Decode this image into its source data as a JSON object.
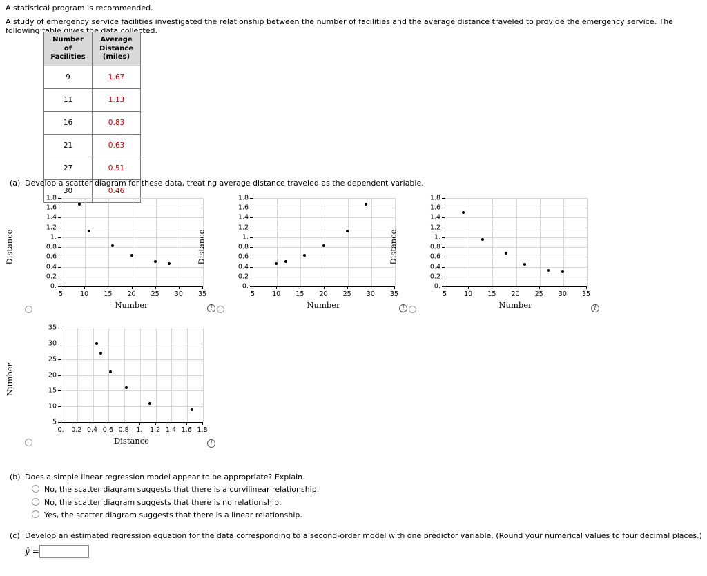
{
  "intro": {
    "line1": "A statistical program is recommended.",
    "line2": "A study of emergency service facilities investigated the relationship between the number of facilities and the average distance traveled to provide the emergency service. The following table gives the data collected."
  },
  "table": {
    "headers": [
      "Number of Facilities",
      "Average Distance (miles)"
    ],
    "header_lines": [
      [
        "Number of",
        "Facilities"
      ],
      [
        "Average",
        "Distance",
        "(miles)"
      ]
    ],
    "rows": [
      {
        "facilities": "9",
        "distance": "1.67"
      },
      {
        "facilities": "11",
        "distance": "1.13"
      },
      {
        "facilities": "16",
        "distance": "0.83"
      },
      {
        "facilities": "21",
        "distance": "0.63"
      },
      {
        "facilities": "27",
        "distance": "0.51"
      },
      {
        "facilities": "30",
        "distance": "0.46"
      }
    ]
  },
  "parts": {
    "a_label": "(a)",
    "a_text": "Develop a scatter diagram for these data, treating average distance traveled as the dependent variable.",
    "b_label": "(b)",
    "b_text": "Does a simple linear regression model appear to be appropriate? Explain.",
    "b_options": [
      "No, the scatter diagram suggests that there is a curvilinear relationship.",
      "No, the scatter diagram suggests that there is no relationship.",
      "Yes, the scatter diagram suggests that there is a linear relationship."
    ],
    "c_label": "(c)",
    "c_text": "Develop an estimated regression equation for the data corresponding to a second-order model with one predictor variable. (Round your numerical values to four decimal places.)",
    "c_yhat": "ŷ =",
    "c_value": ""
  },
  "chart_data": [
    {
      "id": "chart1",
      "type": "scatter",
      "title": "",
      "xlabel": "Number",
      "ylabel": "Distance",
      "xlim": [
        5,
        35
      ],
      "ylim": [
        0,
        1.8
      ],
      "xticks": [
        5,
        10,
        15,
        20,
        25,
        30,
        35
      ],
      "xticklabels": [
        "5",
        "10",
        "15",
        "20",
        "25",
        "30",
        "35"
      ],
      "yticks": [
        0,
        0.2,
        0.4,
        0.6,
        0.8,
        1.0,
        1.2,
        1.4,
        1.6,
        1.8
      ],
      "yticklabels": [
        "0.",
        "0.2",
        "0.4",
        "0.6",
        "0.8",
        "1.",
        "1.2",
        "1.4",
        "1.6",
        "1.8"
      ],
      "grid": true,
      "points": [
        {
          "x": 9,
          "y": 1.67
        },
        {
          "x": 11,
          "y": 1.13
        },
        {
          "x": 16,
          "y": 0.83
        },
        {
          "x": 20,
          "y": 0.63
        },
        {
          "x": 25,
          "y": 0.51
        },
        {
          "x": 28,
          "y": 0.46
        }
      ]
    },
    {
      "id": "chart2",
      "type": "scatter",
      "title": "",
      "xlabel": "Number",
      "ylabel": "Distance",
      "xlim": [
        5,
        35
      ],
      "ylim": [
        0,
        1.8
      ],
      "xticks": [
        5,
        10,
        15,
        20,
        25,
        30,
        35
      ],
      "xticklabels": [
        "5",
        "10",
        "15",
        "20",
        "25",
        "30",
        "35"
      ],
      "yticks": [
        0,
        0.2,
        0.4,
        0.6,
        0.8,
        1.0,
        1.2,
        1.4,
        1.6,
        1.8
      ],
      "yticklabels": [
        "0.",
        "0.2",
        "0.4",
        "0.6",
        "0.8",
        "1.",
        "1.2",
        "1.4",
        "1.6",
        "1.8"
      ],
      "grid": true,
      "points": [
        {
          "x": 10,
          "y": 0.46
        },
        {
          "x": 12,
          "y": 0.51
        },
        {
          "x": 16,
          "y": 0.63
        },
        {
          "x": 20,
          "y": 0.83
        },
        {
          "x": 25,
          "y": 1.13
        },
        {
          "x": 29,
          "y": 1.67
        }
      ]
    },
    {
      "id": "chart3",
      "type": "scatter",
      "title": "",
      "xlabel": "Number",
      "ylabel": "Distance",
      "xlim": [
        5,
        35
      ],
      "ylim": [
        0,
        1.8
      ],
      "xticks": [
        5,
        10,
        15,
        20,
        25,
        30,
        35
      ],
      "xticklabels": [
        "5",
        "10",
        "15",
        "20",
        "25",
        "30",
        "35"
      ],
      "yticks": [
        0,
        0.2,
        0.4,
        0.6,
        0.8,
        1.0,
        1.2,
        1.4,
        1.6,
        1.8
      ],
      "yticklabels": [
        "0.",
        "0.2",
        "0.4",
        "0.6",
        "0.8",
        "1.",
        "1.2",
        "1.4",
        "1.6",
        "1.8"
      ],
      "grid": true,
      "points": [
        {
          "x": 9,
          "y": 1.5
        },
        {
          "x": 13,
          "y": 0.95
        },
        {
          "x": 18,
          "y": 0.68
        },
        {
          "x": 22,
          "y": 0.45
        },
        {
          "x": 27,
          "y": 0.33
        },
        {
          "x": 30,
          "y": 0.29
        }
      ]
    },
    {
      "id": "chart4",
      "type": "scatter",
      "title": "",
      "xlabel": "Distance",
      "ylabel": "Number",
      "xlim": [
        0,
        1.8
      ],
      "ylim": [
        5,
        35
      ],
      "xticks": [
        0,
        0.2,
        0.4,
        0.6,
        0.8,
        1.0,
        1.2,
        1.4,
        1.6,
        1.8
      ],
      "xticklabels": [
        "0.",
        "0.2",
        "0.4",
        "0.6",
        "0.8",
        "1.",
        "1.2",
        "1.4",
        "1.6",
        "1.8"
      ],
      "yticks": [
        5,
        10,
        15,
        20,
        25,
        30,
        35
      ],
      "yticklabels": [
        "5",
        "10",
        "15",
        "20",
        "25",
        "30",
        "35"
      ],
      "grid": true,
      "points": [
        {
          "x": 0.46,
          "y": 30
        },
        {
          "x": 0.51,
          "y": 27
        },
        {
          "x": 0.63,
          "y": 21
        },
        {
          "x": 0.83,
          "y": 16
        },
        {
          "x": 1.13,
          "y": 11
        },
        {
          "x": 1.67,
          "y": 9
        }
      ]
    }
  ],
  "icons": {
    "info": "i"
  }
}
